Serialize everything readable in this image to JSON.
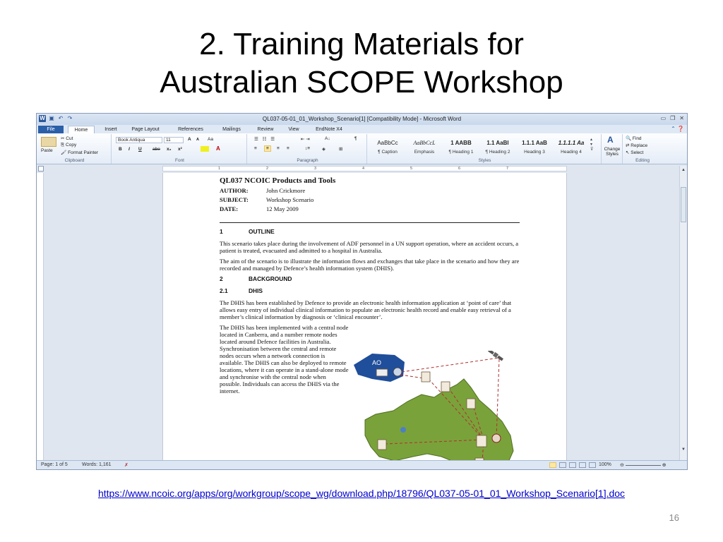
{
  "slide": {
    "title_line1": "2. Training Materials for",
    "title_line2": "Australian SCOPE Workshop",
    "link": "https://www.ncoic.org/apps/org/workgroup/scope_wg/download.php/18796/QL037-05-01_01_Workshop_Scenario[1].doc",
    "page_number": "16"
  },
  "word": {
    "window_title": "QL037-05-01_01_Workshop_Scenario[1] [Compatibility Mode] - Microsoft Word",
    "tabs": [
      "File",
      "Home",
      "Insert",
      "Page Layout",
      "References",
      "Mailings",
      "Review",
      "View",
      "EndNote X4"
    ],
    "active_tab": "Home",
    "clipboard": {
      "paste": "Paste",
      "cut": "Cut",
      "copy": "Copy",
      "format_painter": "Format Painter",
      "label": "Clipboard"
    },
    "font": {
      "name": "Book Antiqua",
      "size": "11",
      "label": "Font",
      "bold": "B",
      "italic": "I",
      "underline": "U",
      "strike": "abe",
      "sub": "x₂",
      "sup": "x²",
      "grow": "A",
      "shrink": "A",
      "case": "Aa"
    },
    "paragraph": {
      "label": "Paragraph",
      "show_marks": "¶"
    },
    "styles": {
      "label": "Styles",
      "items": [
        {
          "sample": "AaBbCc",
          "name": "¶ Caption"
        },
        {
          "sample": "AaBbCcL",
          "name": "Emphasis"
        },
        {
          "sample": "1 AABB",
          "name": "¶ Heading 1"
        },
        {
          "sample": "1.1 AaBl",
          "name": "¶ Heading 2"
        },
        {
          "sample": "1.1.1 AaB",
          "name": "Heading 3"
        },
        {
          "sample": "1.1.1.1 Aa",
          "name": "Heading 4"
        }
      ],
      "change_styles": "Change Styles"
    },
    "editing": {
      "find": "Find",
      "replace": "Replace",
      "select": "Select",
      "label": "Editing"
    },
    "ruler_numbers": [
      "1",
      "2",
      "3",
      "4",
      "5",
      "6",
      "7"
    ],
    "status": {
      "page": "Page: 1 of 5",
      "words": "Words: 1,161",
      "zoom": "100%"
    }
  },
  "document": {
    "title": "QL037 NCOIC Products and Tools",
    "author_label": "AUTHOR:",
    "author": "John Crickmore",
    "subject_label": "SUBJECT:",
    "subject": "Workshop Scenario",
    "date_label": "DATE:",
    "date": "12 May 2009",
    "s1_num": "1",
    "s1_title": "OUTLINE",
    "p1": "This scenario takes place during the involvement of ADF personnel in a UN support operation, where an accident occurs, a patient is treated, evacuated and admitted to a hospital in Australia.",
    "p2": "The aim of the scenario is to illustrate the information flows and exchanges that take place in the scenario and how they are recorded and managed by Defence’s health information system (DHIS).",
    "s2_num": "2",
    "s2_title": "BACKGROUND",
    "s21_num": "2.1",
    "s21_title": "DHIS",
    "p3": "The DHIS has been established by Defence to provide an electronic health information application at ‘point of care’ that allows easy entry of individual clinical information to populate an electronic health record and enable easy retrieval of a member’s clinical information by diagnosis or ‘clinical encounter’.",
    "p4": "The DHIS has been implemented with a central node located in Canberra, and a number remote nodes located around Defence facilities in Australia. Synchronisation between the central and remote nodes occurs when a network connection is available. The DHIS can also be deployed to remote locations, where it can operate in a stand-alone mode and synchronise with the central node when possible. Individuals can access the DHIS via the internet.",
    "diagram_ao_label": "AO"
  },
  "colors": {
    "accent": "#2b579a",
    "map_green": "#7aa23a",
    "ao_blue": "#1f4e9a",
    "link": "#0000cc"
  }
}
